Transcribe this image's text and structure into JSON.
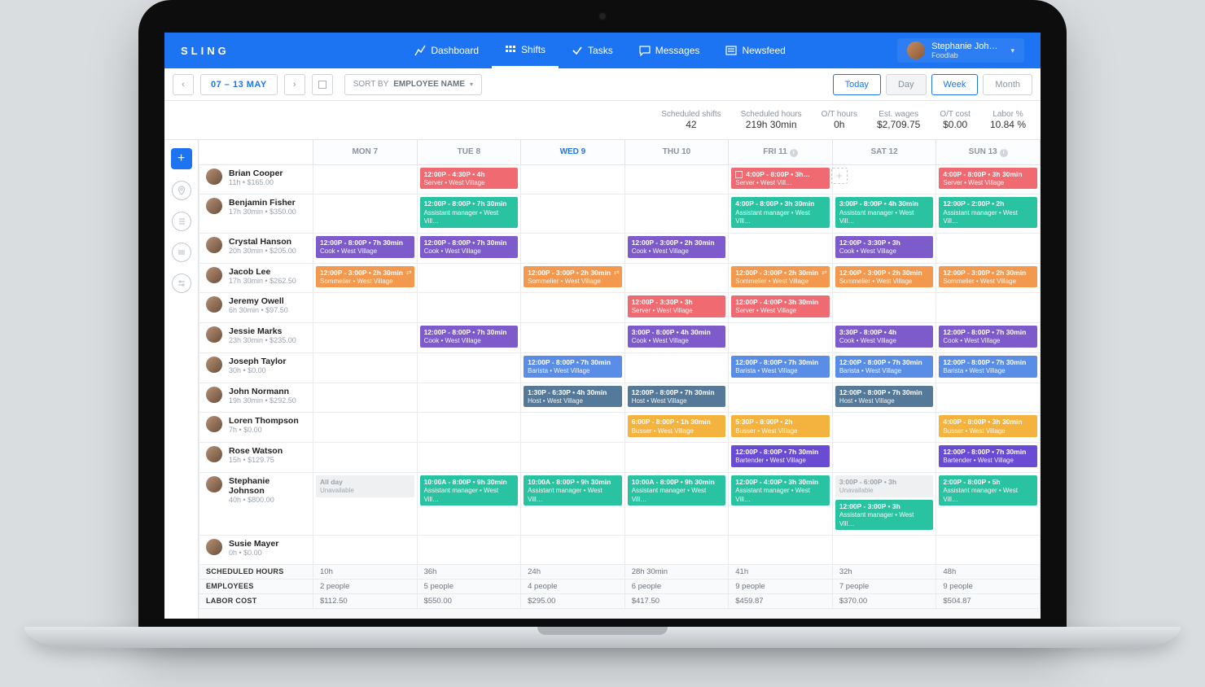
{
  "brand": "SLING",
  "nav": {
    "dashboard": "Dashboard",
    "shifts": "Shifts",
    "tasks": "Tasks",
    "messages": "Messages",
    "newsfeed": "Newsfeed"
  },
  "user": {
    "name": "Stephanie Joh…",
    "org": "Foodlab"
  },
  "toolbar": {
    "date_range": "07 – 13 MAY",
    "sort_label": "SORT BY",
    "sort_value": "EMPLOYEE NAME",
    "today": "Today",
    "day": "Day",
    "week": "Week",
    "month": "Month"
  },
  "stats": [
    {
      "label": "Scheduled shifts",
      "value": "42"
    },
    {
      "label": "Scheduled hours",
      "value": "219h 30min"
    },
    {
      "label": "O/T hours",
      "value": "0h"
    },
    {
      "label": "Est. wages",
      "value": "$2,709.75"
    },
    {
      "label": "O/T cost",
      "value": "$0.00"
    },
    {
      "label": "Labor %",
      "value": "10.84 %"
    }
  ],
  "days": [
    {
      "label": "MON 7"
    },
    {
      "label": "TUE 8"
    },
    {
      "label": "WED 9",
      "today": true
    },
    {
      "label": "THU 10"
    },
    {
      "label": "FRI 11",
      "info": true
    },
    {
      "label": "SAT 12"
    },
    {
      "label": "SUN 13",
      "info": true
    }
  ],
  "colors": {
    "red": "c-red",
    "teal": "c-teal",
    "purple": "c-purple",
    "orange": "c-orange",
    "blue": "c-blue",
    "steel": "c-steel",
    "amber": "c-amber",
    "violet": "c-violet",
    "gray": "unavail"
  },
  "employees": [
    {
      "name": "Brian Cooper",
      "meta": "11h • $165.00",
      "cells": [
        [],
        [
          {
            "t": "12:00P - 4:30P • 4h",
            "r": "Server • West Village",
            "c": "red"
          }
        ],
        [],
        [],
        [
          {
            "t": "4:00P - 8:00P • 3h…",
            "r": "Server • West Vill…",
            "c": "red",
            "check": true,
            "add": true
          }
        ],
        [],
        [
          {
            "t": "4:00P - 8:00P • 3h 30min",
            "r": "Server • West Village",
            "c": "red"
          }
        ]
      ]
    },
    {
      "name": "Benjamin Fisher",
      "meta": "17h 30min • $350.00",
      "cells": [
        [],
        [
          {
            "t": "12:00P - 8:00P • 7h 30min",
            "r": "Assistant manager • West Vill…",
            "c": "teal"
          }
        ],
        [],
        [],
        [
          {
            "t": "4:00P - 8:00P • 3h 30min",
            "r": "Assistant manager • West Vill…",
            "c": "teal"
          }
        ],
        [
          {
            "t": "3:00P - 8:00P • 4h 30min",
            "r": "Assistant manager • West Vill…",
            "c": "teal"
          }
        ],
        [
          {
            "t": "12:00P - 2:00P • 2h",
            "r": "Assistant manager • West Vill…",
            "c": "teal"
          }
        ]
      ]
    },
    {
      "name": "Crystal Hanson",
      "meta": "20h 30min • $205.00",
      "cells": [
        [
          {
            "t": "12:00P - 8:00P • 7h 30min",
            "r": "Cook • West Village",
            "c": "purple"
          }
        ],
        [
          {
            "t": "12:00P - 8:00P • 7h 30min",
            "r": "Cook • West Village",
            "c": "purple"
          }
        ],
        [],
        [
          {
            "t": "12:00P - 3:00P • 2h 30min",
            "r": "Cook • West Village",
            "c": "purple"
          }
        ],
        [],
        [
          {
            "t": "12:00P - 3:30P • 3h",
            "r": "Cook • West Village",
            "c": "purple"
          }
        ],
        []
      ]
    },
    {
      "name": "Jacob Lee",
      "meta": "17h 30min • $262.50",
      "cells": [
        [
          {
            "t": "12:00P - 3:00P • 2h 30min",
            "r": "Sommelier • West Village",
            "c": "orange",
            "swap": true
          }
        ],
        [],
        [
          {
            "t": "12:00P - 3:00P • 2h 30min",
            "r": "Sommelier • West Village",
            "c": "orange",
            "swap": true
          }
        ],
        [],
        [
          {
            "t": "12:00P - 3:00P • 2h 30min",
            "r": "Sommelier • West Village",
            "c": "orange",
            "swap": true
          }
        ],
        [
          {
            "t": "12:00P - 3:00P • 2h 30min",
            "r": "Sommelier • West Village",
            "c": "orange"
          }
        ],
        [
          {
            "t": "12:00P - 3:00P • 2h 30min",
            "r": "Sommelier • West Village",
            "c": "orange"
          }
        ]
      ]
    },
    {
      "name": "Jeremy Owell",
      "meta": "6h 30min • $97.50",
      "cells": [
        [],
        [],
        [],
        [
          {
            "t": "12:00P - 3:30P • 3h",
            "r": "Server • West Village",
            "c": "red"
          }
        ],
        [
          {
            "t": "12:00P - 4:00P • 3h 30min",
            "r": "Server • West Village",
            "c": "red"
          }
        ],
        [],
        []
      ]
    },
    {
      "name": "Jessie Marks",
      "meta": "23h 30min • $235.00",
      "cells": [
        [],
        [
          {
            "t": "12:00P - 8:00P • 7h 30min",
            "r": "Cook • West Village",
            "c": "purple"
          }
        ],
        [],
        [
          {
            "t": "3:00P - 8:00P • 4h 30min",
            "r": "Cook • West Village",
            "c": "purple"
          }
        ],
        [],
        [
          {
            "t": "3:30P - 8:00P • 4h",
            "r": "Cook • West Village",
            "c": "purple"
          }
        ],
        [
          {
            "t": "12:00P - 8:00P • 7h 30min",
            "r": "Cook • West Village",
            "c": "purple"
          }
        ]
      ]
    },
    {
      "name": "Joseph Taylor",
      "meta": "30h • $0.00",
      "cells": [
        [],
        [],
        [
          {
            "t": "12:00P - 8:00P • 7h 30min",
            "r": "Barista • West Village",
            "c": "blue"
          }
        ],
        [],
        [
          {
            "t": "12:00P - 8:00P • 7h 30min",
            "r": "Barista • West Village",
            "c": "blue"
          }
        ],
        [
          {
            "t": "12:00P - 8:00P • 7h 30min",
            "r": "Barista • West Village",
            "c": "blue"
          }
        ],
        [
          {
            "t": "12:00P - 8:00P • 7h 30min",
            "r": "Barista • West Village",
            "c": "blue"
          }
        ]
      ]
    },
    {
      "name": "John Normann",
      "meta": "19h 30min • $292.50",
      "cells": [
        [],
        [],
        [
          {
            "t": "1:30P - 6:30P • 4h 30min",
            "r": "Host • West Village",
            "c": "steel"
          }
        ],
        [
          {
            "t": "12:00P - 8:00P • 7h 30min",
            "r": "Host • West Village",
            "c": "steel"
          }
        ],
        [],
        [
          {
            "t": "12:00P - 8:00P • 7h 30min",
            "r": "Host • West Village",
            "c": "steel"
          }
        ],
        []
      ]
    },
    {
      "name": "Loren Thompson",
      "meta": "7h • $0.00",
      "cells": [
        [],
        [],
        [],
        [
          {
            "t": "6:00P - 8:00P • 1h 30min",
            "r": "Busser • West Village",
            "c": "amber"
          }
        ],
        [
          {
            "t": "5:30P - 8:00P • 2h",
            "r": "Busser • West Village",
            "c": "amber"
          }
        ],
        [],
        [
          {
            "t": "4:00P - 8:00P • 3h 30min",
            "r": "Busser • West Village",
            "c": "amber"
          }
        ]
      ]
    },
    {
      "name": "Rose Watson",
      "meta": "15h • $129.75",
      "cells": [
        [],
        [],
        [],
        [],
        [
          {
            "t": "12:00P - 8:00P • 7h 30min",
            "r": "Bartender • West Village",
            "c": "violet"
          }
        ],
        [],
        [
          {
            "t": "12:00P - 8:00P • 7h 30min",
            "r": "Bartender • West Village",
            "c": "violet"
          }
        ]
      ]
    },
    {
      "name": "Stephanie Johnson",
      "meta": "40h • $800.00",
      "cells": [
        [
          {
            "t": "All day",
            "r": "Unavailable",
            "c": "gray"
          }
        ],
        [
          {
            "t": "10:00A - 8:00P • 9h 30min",
            "r": "Assistant manager • West Vill…",
            "c": "teal"
          }
        ],
        [
          {
            "t": "10:00A - 8:00P • 9h 30min",
            "r": "Assistant manager • West Vill…",
            "c": "teal"
          }
        ],
        [
          {
            "t": "10:00A - 8:00P • 9h 30min",
            "r": "Assistant manager • West Vill…",
            "c": "teal"
          }
        ],
        [
          {
            "t": "12:00P - 4:00P • 3h 30min",
            "r": "Assistant manager • West Vill…",
            "c": "teal"
          }
        ],
        [
          {
            "t": "3:00P - 6:00P • 3h",
            "r": "Unavailable",
            "c": "gray"
          },
          {
            "t": "12:00P - 3:00P • 3h",
            "r": "Assistant manager • West Vill…",
            "c": "teal"
          }
        ],
        [
          {
            "t": "2:00P - 8:00P • 5h",
            "r": "Assistant manager • West Vill…",
            "c": "teal"
          }
        ]
      ]
    },
    {
      "name": "Susie Mayer",
      "meta": "0h • $0.00",
      "cells": [
        [],
        [],
        [],
        [],
        [],
        [],
        []
      ]
    }
  ],
  "summary": {
    "rows": [
      "SCHEDULED HOURS",
      "EMPLOYEES",
      "LABOR COST"
    ],
    "values": [
      [
        "10h",
        "36h",
        "24h",
        "28h 30min",
        "41h",
        "32h",
        "48h"
      ],
      [
        "2 people",
        "5 people",
        "4 people",
        "6 people",
        "9 people",
        "7 people",
        "9 people"
      ],
      [
        "$112.50",
        "$550.00",
        "$295.00",
        "$417.50",
        "$459.87",
        "$370.00",
        "$504.87"
      ]
    ]
  }
}
